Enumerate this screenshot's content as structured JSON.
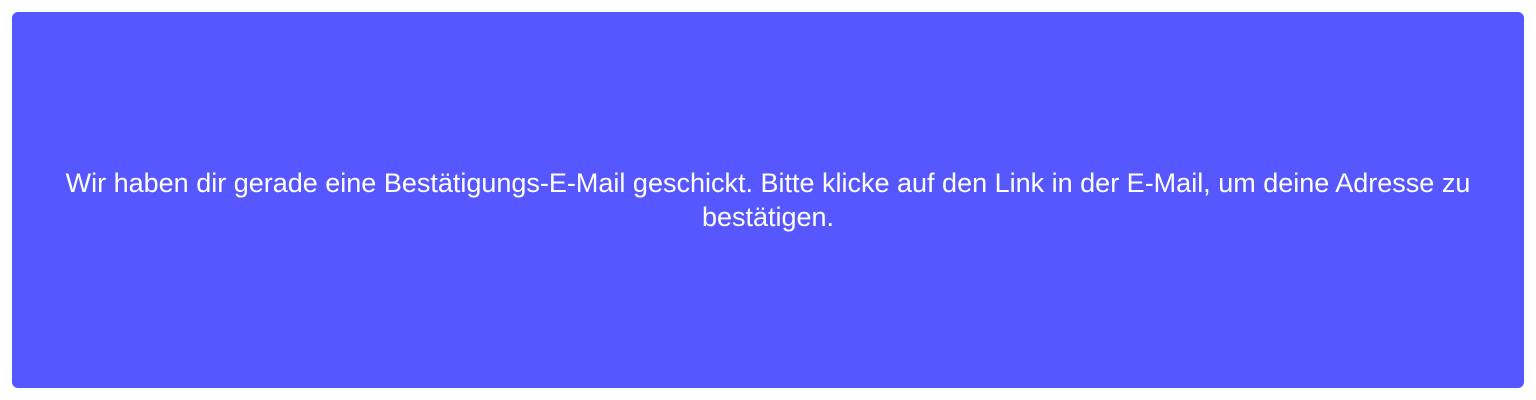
{
  "colors": {
    "panel_background": "#5757ff",
    "text": "#ffffff",
    "page_background": "#ffffff"
  },
  "notice": {
    "message": "Wir haben dir gerade eine Bestätigungs-E-Mail geschickt. Bitte klicke auf den Link in der E-Mail, um deine Adresse zu bestätigen."
  }
}
